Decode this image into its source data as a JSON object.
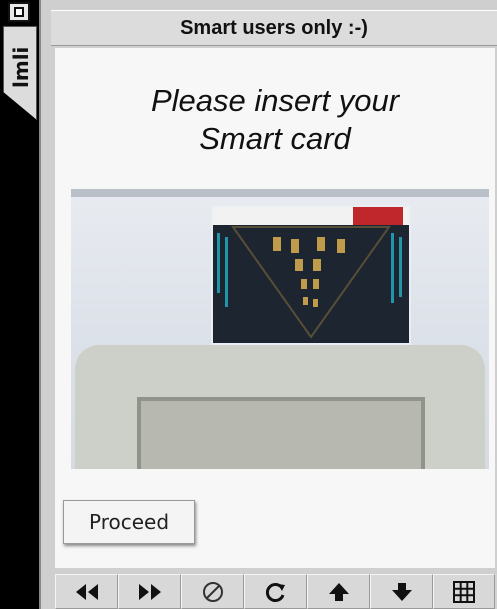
{
  "side_tab": {
    "label": "lmli",
    "icon": "window-box-icon"
  },
  "window": {
    "title": "Smart users only :-)"
  },
  "main": {
    "heading_line1": "Please insert your",
    "heading_line2": "Smart card",
    "photo": {
      "description_icon": "smart-card-reader-photo"
    },
    "proceed_label": "Proceed"
  },
  "navbar": {
    "buttons": [
      {
        "icon": "rewind-icon"
      },
      {
        "icon": "fast-forward-icon"
      },
      {
        "icon": "stop-icon"
      },
      {
        "icon": "reload-icon"
      },
      {
        "icon": "arrow-up-icon"
      },
      {
        "icon": "arrow-down-icon"
      },
      {
        "icon": "grid-icon"
      }
    ]
  },
  "colors": {
    "window_bg": "#cfcfcf",
    "content_bg": "#f7f7f7",
    "frame": "#000000"
  }
}
